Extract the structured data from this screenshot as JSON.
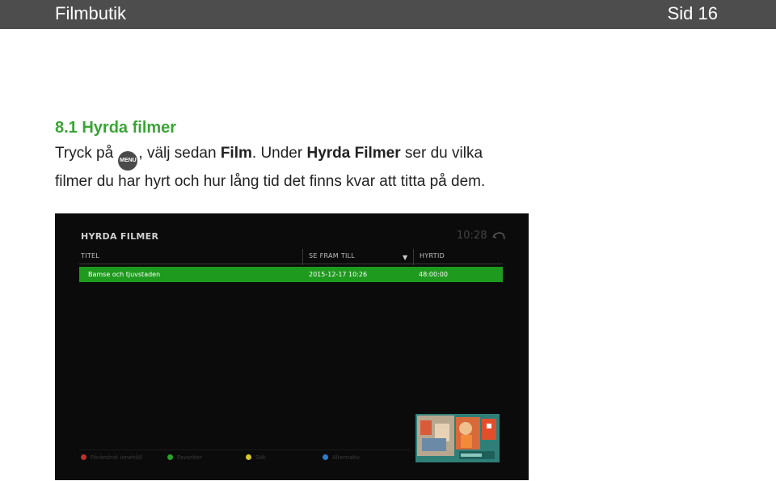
{
  "header": {
    "title": "Filmbutik",
    "page": "Sid 16"
  },
  "section": {
    "heading": "8.1 Hyrda filmer",
    "line1_a": "Tryck på ",
    "menu_icon_label": "MENU",
    "line1_b": ", välj sedan ",
    "film": "Film",
    "line1_c": ". Under ",
    "hyrda_filmer": "Hyrda Filmer",
    "line1_d": " ser du vilka",
    "line2": "filmer du har hyrt och hur lång tid det finns kvar att titta på dem."
  },
  "tv": {
    "title": "HYRDA FILMER",
    "clock": "10:28",
    "columns": {
      "title": "TITEL",
      "until": "SE FRAM TILL",
      "rented": "HYRTID"
    },
    "rows": [
      {
        "title": "Bamse och tjuvstaden",
        "until": "2015-12-17 10:26",
        "time": "48:00:00"
      }
    ],
    "legend": [
      {
        "label": "Förändrat innehåll",
        "color": "#c0302b"
      },
      {
        "label": "Favoriter",
        "color": "#2aa22a"
      },
      {
        "label": "Sök",
        "color": "#d2c62a"
      },
      {
        "label": "Alternativ",
        "color": "#2a7bd2"
      }
    ]
  }
}
